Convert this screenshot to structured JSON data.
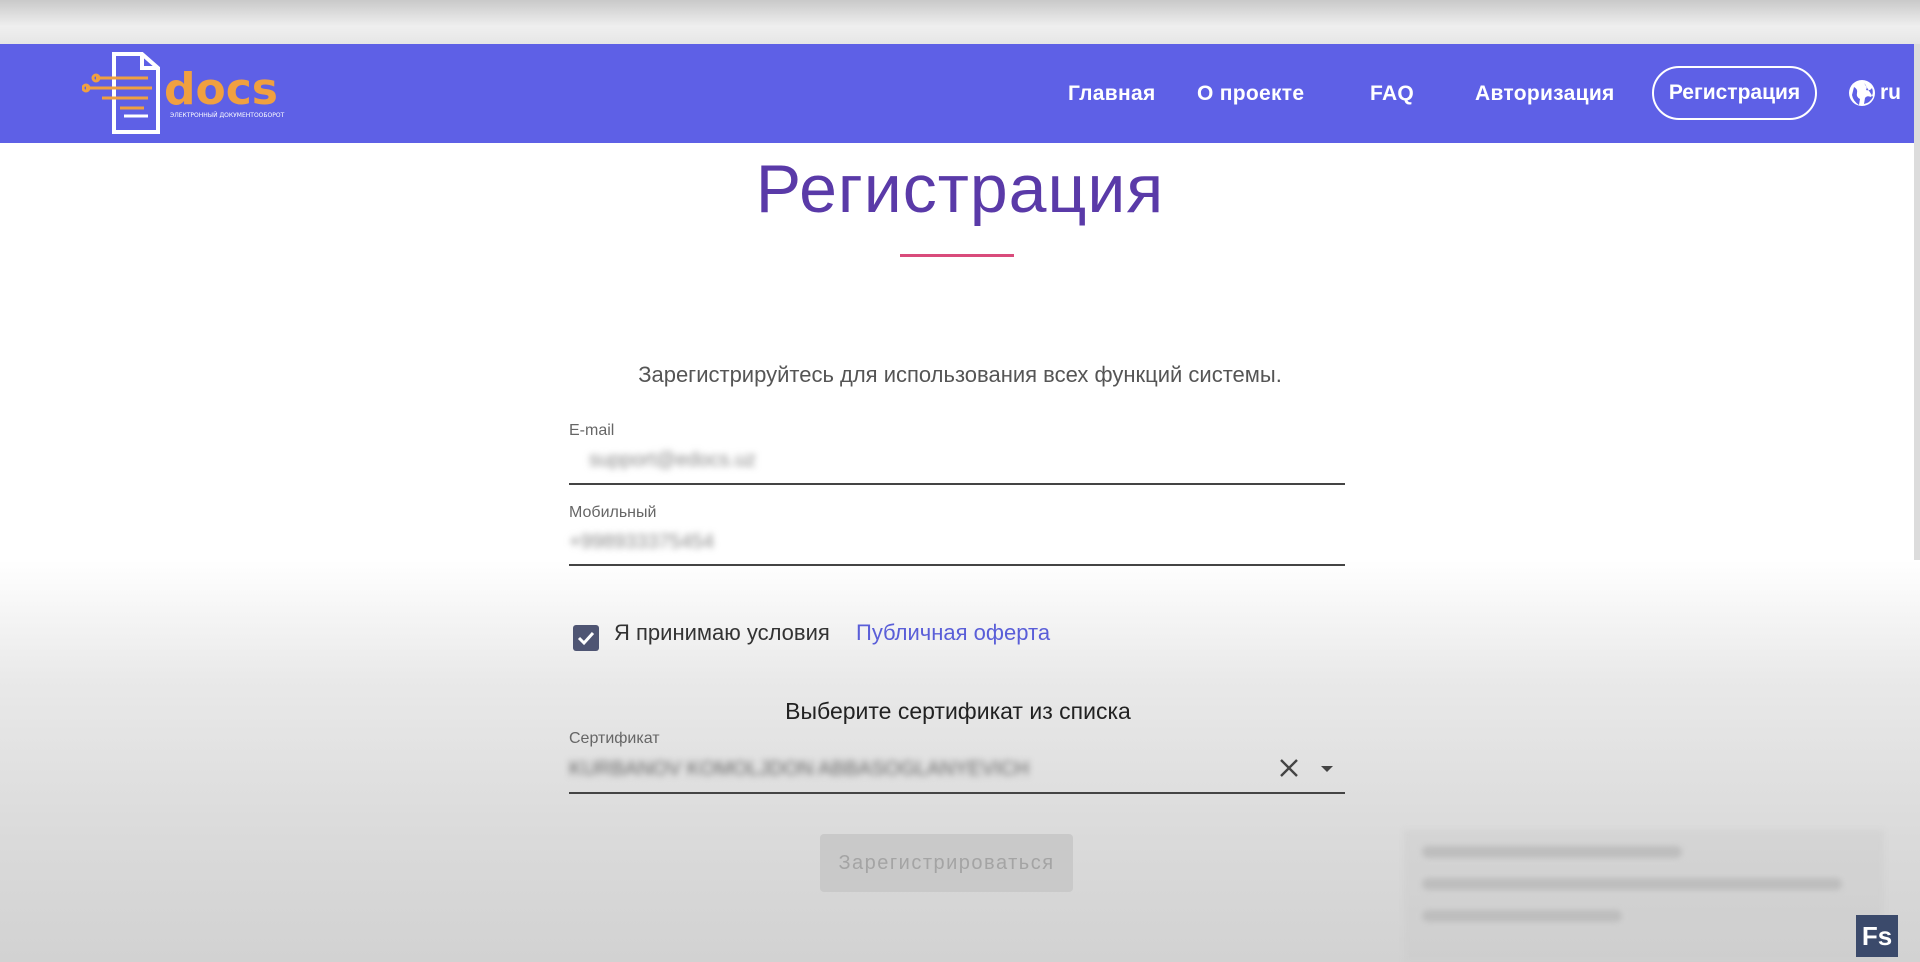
{
  "header": {
    "logo_text": "docs",
    "logo_subtitle": "ЭЛЕКТРОННЫЙ ДОКУМЕНТООБОРОТ",
    "nav": {
      "home": "Главная",
      "about": "О проекте",
      "faq": "FAQ",
      "login": "Авторизация",
      "register": "Регистрация"
    },
    "language": "ru",
    "nav_color": "#5e60e6"
  },
  "main": {
    "title": "Регистрация",
    "subtitle": "Зарегистрируйтесь для использования всех функций системы.",
    "email": {
      "label": "E-mail",
      "value": "support@edocs.uz"
    },
    "mobile": {
      "label": "Мобильный",
      "value": "+998933375454"
    },
    "terms": {
      "checked": true,
      "text": "Я принимаю условия",
      "link": "Публичная оферта"
    },
    "certificate": {
      "prompt": "Выберите сертификат из списка",
      "label": "Сертификат",
      "value": "KURBANOV KOMOLJDON ABBASOGLANYEVICH"
    },
    "submit_label": "Зарегистрироваться"
  },
  "badge": {
    "text": "Fs"
  }
}
